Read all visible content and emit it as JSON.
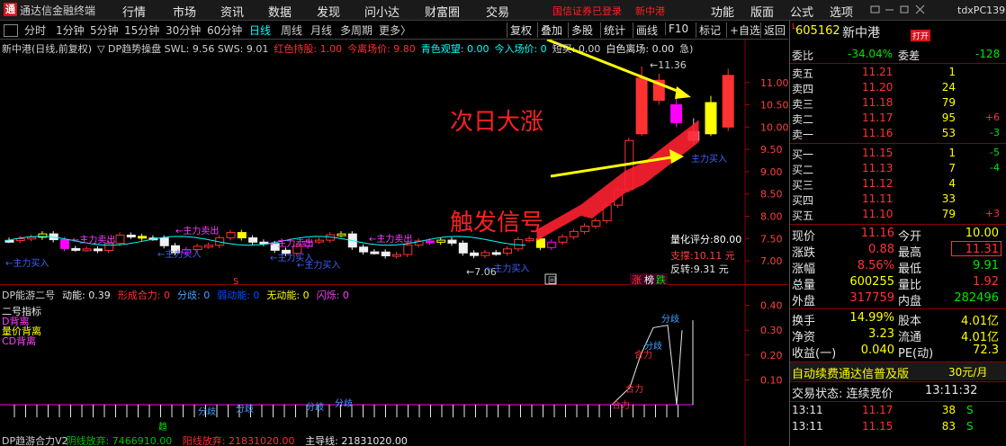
{
  "app": {
    "title": "通达信金融终端",
    "logo": "通",
    "pc_name": "tdxPC139"
  },
  "menu": [
    "行情",
    "市场",
    "资讯",
    "数据",
    "发现",
    "问小达",
    "财富圈",
    "交易"
  ],
  "login": {
    "status": "国信证券已登录",
    "stock": "新中港"
  },
  "right_menu": [
    "功能",
    "版面",
    "公式",
    "选项"
  ],
  "toolbar": {
    "periods": [
      "分时",
      "1分钟",
      "5分钟",
      "15分钟",
      "30分钟",
      "60分钟",
      "日线",
      "周线",
      "月线",
      "多周期",
      "更多〉"
    ],
    "active": "日线",
    "right_buttons": [
      "复权",
      "叠加",
      "多股",
      "统计",
      "画线",
      "F10",
      "标记",
      "+自选",
      "返回"
    ]
  },
  "main_chart": {
    "legend": [
      {
        "text": "新中港(日线,前复权)",
        "color": "#d0d0d0"
      },
      {
        "text": "▽ DP趋势操盘  SWL: 9.56  SWS: 9.01",
        "color": "#d0d0d0"
      },
      {
        "text": "红色持股: 1.00",
        "color": "#ff3030"
      },
      {
        "text": "今离场价: 9.80",
        "color": "#ff3030"
      },
      {
        "text": "青色观望: 0.00",
        "color": "#00ffff"
      },
      {
        "text": "今入场价: 0",
        "color": "#00ffff"
      },
      {
        "text": "短买: 0.00",
        "color": "#d0d0d0"
      },
      {
        "text": "白色离场: 0.00",
        "color": "#e6e6e6"
      },
      {
        "text": "急)",
        "color": "#d0d0d0"
      }
    ],
    "y_ticks": [
      "11.00",
      "10.50",
      "10.00",
      "9.50",
      "9.00",
      "8.50",
      "8.00",
      "7.50",
      "7.00"
    ],
    "ylim": [
      6.7,
      11.6
    ],
    "annotations": {
      "big_rise": "次日大涨",
      "trigger": "触发信号",
      "max_price": "11.36",
      "min_price": "7.06",
      "score": "量化评分:80.00",
      "support": "支撑:10.11 元",
      "reversal": "反转:9.31 元",
      "main_buy": "主力买入",
      "main_sell": "主力卖出",
      "arrow_sell": "←主力卖出",
      "arrow_buy": "←主力买入",
      "s_mark": "S",
      "zhang": "涨",
      "bang": "榜",
      "die": "跌",
      "box": "回"
    }
  },
  "sub_chart": {
    "legend": [
      {
        "text": "DP能游二号",
        "color": "#d0d0d0"
      },
      {
        "text": "动能: 0.39",
        "color": "#e6e6e6"
      },
      {
        "text": "形成合力: 0",
        "color": "#ff3030"
      },
      {
        "text": "分歧: 0",
        "color": "#40a0ff"
      },
      {
        "text": "弱动能: 0",
        "color": "#0050ff"
      },
      {
        "text": "无动能: 0",
        "color": "#ffff00"
      },
      {
        "text": "闪烁: 0",
        "color": "#ff40ff"
      }
    ],
    "side_labels": [
      "二号指标",
      "D背离",
      "量价背离",
      "CD背离"
    ],
    "y_ticks": [
      "0.40",
      "0.30",
      "0.20",
      "0.10"
    ],
    "ylim": [
      -0.05,
      0.42
    ],
    "bottom_legend": [
      {
        "text": "DP趋游合力V2",
        "color": "#d0d0d0"
      },
      {
        "text": "阴线放弃: 7466910.00",
        "color": "#00c000"
      },
      {
        "text": "阳线放弃: 21831020.00",
        "color": "#ff3030"
      },
      {
        "text": "主导线: 21831020.00",
        "color": "#e6e6e6"
      }
    ],
    "tags": {
      "fen": "分歧",
      "he": "合力",
      "qu": "趋"
    }
  },
  "quote": {
    "code": "605162",
    "name": "新中港",
    "badge": "打开",
    "l_mark": "L",
    "weibi_label": "委比",
    "weibi": "-34.04%",
    "weicha_label": "委差",
    "weicha": "-128",
    "sells": [
      {
        "label": "卖五",
        "price": "11.21",
        "vol": "1",
        "chg": ""
      },
      {
        "label": "卖四",
        "price": "11.20",
        "vol": "24",
        "chg": ""
      },
      {
        "label": "卖三",
        "price": "11.18",
        "vol": "79",
        "chg": ""
      },
      {
        "label": "卖二",
        "price": "11.17",
        "vol": "95",
        "chg": "+6"
      },
      {
        "label": "卖一",
        "price": "11.16",
        "vol": "53",
        "chg": "-3"
      }
    ],
    "buys": [
      {
        "label": "买一",
        "price": "11.15",
        "vol": "1",
        "chg": "-5"
      },
      {
        "label": "买二",
        "price": "11.13",
        "vol": "7",
        "chg": "-4"
      },
      {
        "label": "买三",
        "price": "11.12",
        "vol": "4",
        "chg": ""
      },
      {
        "label": "买四",
        "price": "11.11",
        "vol": "33",
        "chg": ""
      },
      {
        "label": "买五",
        "price": "11.10",
        "vol": "79",
        "chg": "+3"
      }
    ],
    "stats": [
      {
        "l1": "现价",
        "v1": "11.16",
        "c1": "red",
        "l2": "今开",
        "v2": "10.00",
        "c2": "yel"
      },
      {
        "l1": "涨跌",
        "v1": "0.88",
        "c1": "red",
        "l2": "最高",
        "v2": "11.31",
        "c2": "red"
      },
      {
        "l1": "涨幅",
        "v1": "8.56%",
        "c1": "red",
        "l2": "最低",
        "v2": "9.91",
        "c2": "green"
      },
      {
        "l1": "总量",
        "v1": "600255",
        "c1": "yel",
        "l2": "量比",
        "v2": "1.92",
        "c2": "red"
      },
      {
        "l1": "外盘",
        "v1": "317759",
        "c1": "red",
        "l2": "内盘",
        "v2": "282496",
        "c2": "green"
      }
    ],
    "stats2": [
      {
        "l1": "换手",
        "v1": "14.99%",
        "l2": "股本",
        "v2": "4.01亿"
      },
      {
        "l1": "净资",
        "v1": "3.23",
        "l2": "流通",
        "v2": "4.01亿"
      },
      {
        "l1": "收益(一)",
        "v1": "0.040",
        "l2": "PE(动)",
        "v2": "72.3"
      }
    ],
    "ad": "自动续费通达信普及版",
    "ad_price": "30元/月",
    "trade_status": "交易状态: 连续竞价",
    "trade_time": "13:11:32",
    "ticks": [
      {
        "time": "13:11",
        "price": "11.17",
        "vol": "38",
        "bs": "S"
      },
      {
        "time": "13:11",
        "price": "11.15",
        "vol": "83",
        "bs": "S"
      }
    ]
  },
  "colors": {
    "up": "#ff3232",
    "down": "#00e600",
    "bg": "#000000",
    "accent": "#00ffff",
    "ribbon": "#ff2030",
    "wave": "#ff00ff"
  }
}
